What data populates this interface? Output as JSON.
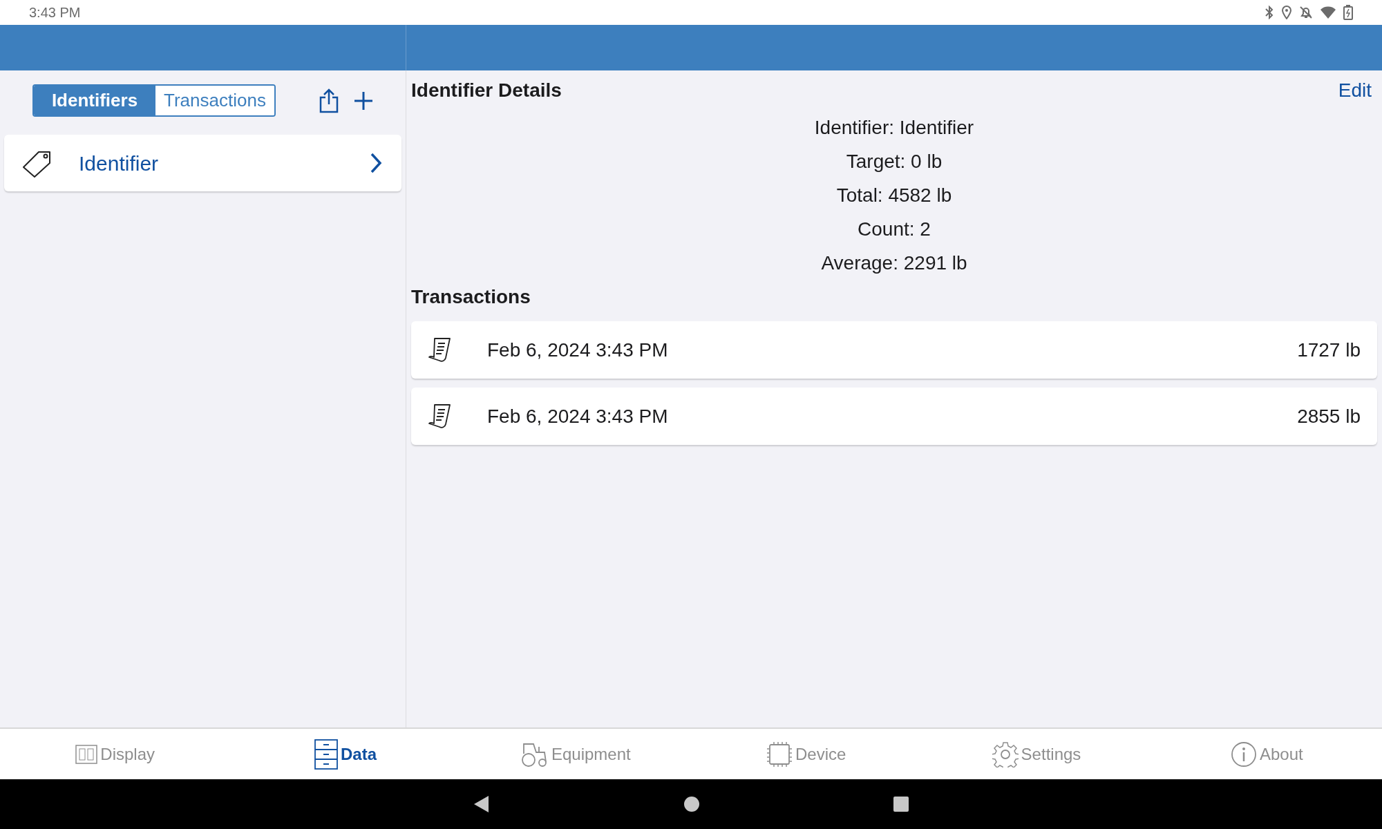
{
  "status_bar": {
    "time": "3:43 PM"
  },
  "segments": [
    {
      "label": "Identifiers",
      "selected": true
    },
    {
      "label": "Transactions",
      "selected": false
    }
  ],
  "identifiers": [
    {
      "name": "Identifier"
    }
  ],
  "details": {
    "title": "Identifier Details",
    "edit": "Edit",
    "lines": [
      "Identifier: Identifier",
      "Target: 0 lb",
      "Total: 4582 lb",
      "Count: 2",
      "Average: 2291 lb"
    ]
  },
  "transactions": {
    "title": "Transactions",
    "rows": [
      {
        "date": "Feb 6, 2024 3:43 PM",
        "weight": "1727 lb"
      },
      {
        "date": "Feb 6, 2024 3:43 PM",
        "weight": "2855 lb"
      }
    ]
  },
  "tabs": [
    {
      "label": "Display",
      "selected": false
    },
    {
      "label": "Data",
      "selected": true
    },
    {
      "label": "Equipment",
      "selected": false
    },
    {
      "label": "Device",
      "selected": false
    },
    {
      "label": "Settings",
      "selected": false
    },
    {
      "label": "About",
      "selected": false
    }
  ]
}
